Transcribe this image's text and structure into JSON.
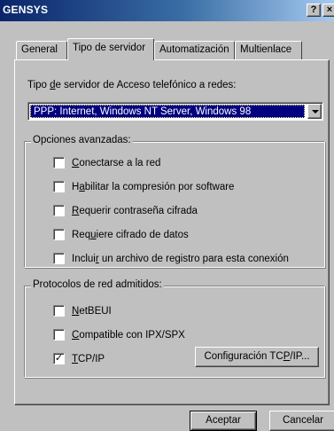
{
  "window": {
    "title": "GENSYS",
    "help_button": "?",
    "close_button": "×"
  },
  "tabs": [
    {
      "label": "General",
      "active": false
    },
    {
      "label": "Tipo de servidor",
      "active": true
    },
    {
      "label": "Automatización",
      "active": false
    },
    {
      "label": "Multienlace",
      "active": false
    }
  ],
  "server_type": {
    "label_pre": "Tipo ",
    "label_access": "d",
    "label_post": "e servidor de Acceso telefónico a redes:",
    "selected_value": "PPP: Internet, Windows NT Server, Windows 98"
  },
  "advanced_options": {
    "title": "Opciones avanzadas:",
    "items": [
      {
        "pre": "",
        "key": "C",
        "post": "onectarse a la red",
        "checked": false
      },
      {
        "pre": "H",
        "key": "a",
        "post": "bilitar la compresión por software",
        "checked": false
      },
      {
        "pre": "",
        "key": "R",
        "post": "equerir contraseña cifrada",
        "checked": false
      },
      {
        "pre": "Req",
        "key": "u",
        "post": "iere cifrado de datos",
        "checked": false
      },
      {
        "pre": "Inclui",
        "key": "r",
        "post": " un archivo de registro para esta conexión",
        "checked": false
      }
    ]
  },
  "protocols": {
    "title": "Protocolos de red admitidos:",
    "items": [
      {
        "pre": "",
        "key": "N",
        "post": "etBEUI",
        "checked": false
      },
      {
        "pre": "",
        "key": "C",
        "post": "ompatible con IPX/SPX",
        "checked": false
      },
      {
        "pre": "",
        "key": "T",
        "post": "CP/IP",
        "checked": true
      }
    ],
    "tcpip_button": {
      "pre": "Configuración TC",
      "key": "P",
      "post": "/IP..."
    }
  },
  "footer": {
    "ok_label": "Aceptar",
    "cancel_label": "Cancelar"
  },
  "check_mark": "✓"
}
